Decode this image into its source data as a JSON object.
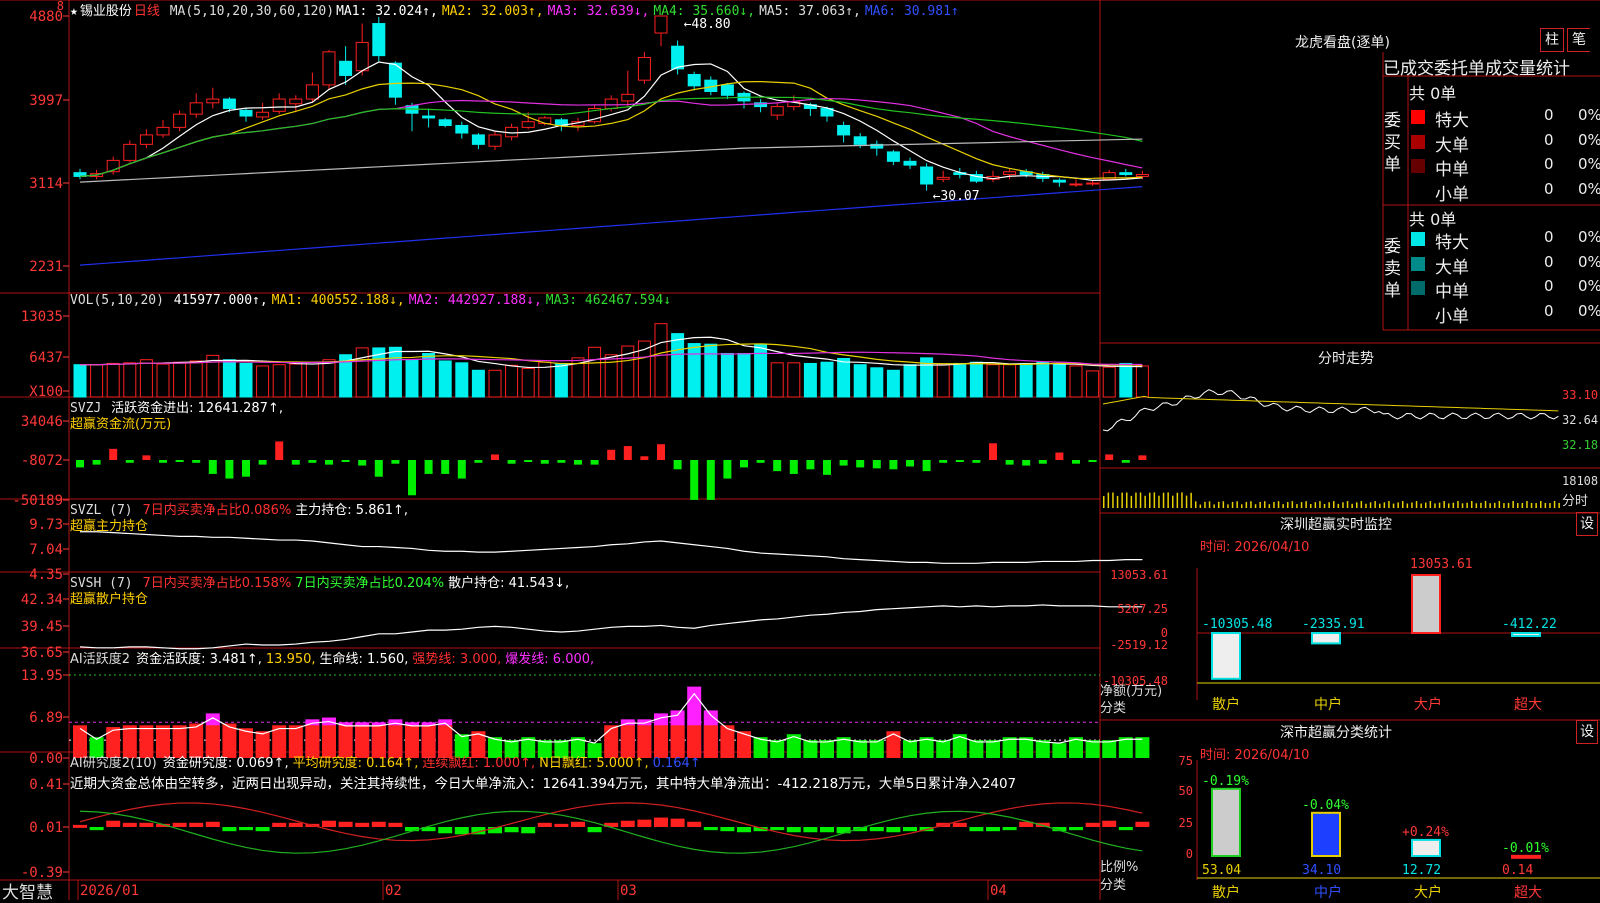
{
  "stock": {
    "name": "锡业股份",
    "period": "日线",
    "star": "★"
  },
  "header": {
    "ma": {
      "label": "MA(5,10,20,30,60,120)",
      "items": [
        {
          "t": "MA1: 32.024↑,",
          "c": "#ffffff"
        },
        {
          "t": "MA2: 32.003↑,",
          "c": "#ffd000"
        },
        {
          "t": "MA3: 32.639↓,",
          "c": "#ff30ff"
        },
        {
          "t": "MA4: 35.660↓,",
          "c": "#30dd30"
        },
        {
          "t": "MA5: 37.063↑,",
          "c": "#dddddd"
        },
        {
          "t": "MA6: 30.981↑",
          "c": "#3050ff"
        }
      ]
    },
    "vol": {
      "label": "VOL(5,10,20)",
      "items": [
        {
          "t": "415977.000↑,",
          "c": "#ffffff"
        },
        {
          "t": "MA1: 400552.188↓,",
          "c": "#ffd000"
        },
        {
          "t": "MA2: 442927.188↓,",
          "c": "#ff30ff"
        },
        {
          "t": "MA3: 462467.594↓",
          "c": "#30dd30"
        }
      ]
    },
    "svzj": {
      "label": "SVZJ",
      "items": [
        {
          "t": "活跃资金进出: 12641.287↑,",
          "c": "#ffffff"
        }
      ],
      "sub": "超赢资金流(万元)"
    },
    "svzl": {
      "label": "SVZL (7)",
      "items": [
        {
          "t": "7日内买卖净占比0.086%",
          "c": "#ff3030"
        },
        {
          "t": "主力持仓: 5.861↑,",
          "c": "#ffffff"
        }
      ],
      "sub": "超赢主力持仓"
    },
    "svsh": {
      "label": "SVSH (7)",
      "items": [
        {
          "t": "7日内买卖净占比0.158%",
          "c": "#ff3030"
        },
        {
          "t": "7日内买卖净占比0.204%",
          "c": "#30ff30"
        },
        {
          "t": "散户持仓: 41.543↓,",
          "c": "#ffffff"
        }
      ],
      "sub": "超赢散户持仓"
    },
    "ai": {
      "label": "AI活跃度2",
      "items": [
        {
          "t": "资金活跃度: 3.481↑,",
          "c": "#ffffff"
        },
        {
          "t": "13.950,",
          "c": "#ffd000"
        },
        {
          "t": "生命线: 1.560,",
          "c": "#ffffff"
        },
        {
          "t": "强势线: 3.000,",
          "c": "#ff3030"
        },
        {
          "t": "爆发线: 6.000,",
          "c": "#ff30ff"
        }
      ]
    },
    "ai2": {
      "label": "AI研究度2(10)",
      "items": [
        {
          "t": "资金研究度: 0.069↑,",
          "c": "#ffffff"
        },
        {
          "t": "平均研究度: 0.164↑,",
          "c": "#ffd000"
        },
        {
          "t": "连续飘红: 1.000↑,",
          "c": "#ff3030"
        },
        {
          "t": "N日飘红: 5.000↑,",
          "c": "#ffd000"
        },
        {
          "t": "0.164↑",
          "c": "#3050ff"
        }
      ],
      "comment": "近期大资金总体由空转多，近两日出现异动，关注其持续性，今日大单净流入：12641.394万元，其中特大单净流出：-412.218万元，大单5日累计净入2407"
    }
  },
  "axes": {
    "price": [
      "4880",
      "3997",
      "3114",
      "2231"
    ],
    "vol": [
      "13035",
      "6437",
      "X100"
    ],
    "svzj": [
      "34046",
      "-8072",
      "-50189"
    ],
    "svzl": [
      "9.73",
      "7.04",
      "4.35"
    ],
    "svsh": [
      "42.34",
      "39.45",
      "36.65"
    ],
    "ai": [
      "13.95",
      "6.89",
      "0.00"
    ],
    "ai2": [
      "0.41",
      "0.01",
      "-0.39"
    ]
  },
  "annotations": {
    "high": "48.80",
    "low": "30.07",
    "left_top_marker": "8"
  },
  "dates": {
    "labels": [
      "2026/01",
      "02",
      "03",
      "04"
    ],
    "brand": "大智慧"
  },
  "right": {
    "dragon": {
      "title": "龙虎看盘(逐单)",
      "btn1": "柱",
      "btn2": "笔",
      "tabs": "已成交委托单成交量统计",
      "buy": {
        "side": "委买单",
        "total": "共 0单",
        "rows": [
          {
            "name": "特大",
            "val": "0",
            "pct": "0%",
            "color": "#ff0000"
          },
          {
            "name": "大单",
            "val": "0",
            "pct": "0%",
            "color": "#aa0000"
          },
          {
            "name": "中单",
            "val": "0",
            "pct": "0%",
            "color": "#660000"
          },
          {
            "name": "小单",
            "val": "0",
            "pct": "0%",
            "color": "#000000"
          }
        ]
      },
      "sell": {
        "side": "委卖单",
        "total": "共 0单",
        "rows": [
          {
            "name": "特大",
            "val": "0",
            "pct": "0%",
            "color": "#00e5e5"
          },
          {
            "name": "大单",
            "val": "0",
            "pct": "0%",
            "color": "#008b8b"
          },
          {
            "name": "中单",
            "val": "0",
            "pct": "0%",
            "color": "#006b6b"
          },
          {
            "name": "小单",
            "val": "0",
            "pct": "0%",
            "color": "#000000"
          }
        ]
      }
    },
    "intraday": {
      "title": "分时走势",
      "prices": [
        "33.10",
        "32.64",
        "32.18"
      ],
      "vol": "18108",
      "vlabel": "分时"
    },
    "sz_monitor": {
      "title": "深圳超赢实时监控",
      "btn": "设",
      "time": "时间: 2026/04/10",
      "yticks": [
        "13053.61",
        "5267.25",
        "0",
        "-2519.12",
        "-10305.48"
      ],
      "ylabel": "净额(万元)",
      "xlabel": "分类"
    },
    "sz_class": {
      "title": "深市超赢分类统计",
      "btn": "设",
      "time": "时间: 2026/04/10",
      "yticks": [
        "75",
        "50",
        "25",
        "0"
      ],
      "ylabel": "比例%",
      "xlabel": "分类"
    }
  },
  "chart_data": [
    {
      "type": "candlestick",
      "title": "锡业股份 日线",
      "ylim": [
        2231,
        4880
      ],
      "x": [
        "2026/01",
        "02",
        "03",
        "04"
      ],
      "ohlc": [
        [
          3220,
          3180,
          3260,
          3150
        ],
        [
          3180,
          3210,
          3250,
          3150
        ],
        [
          3230,
          3350,
          3390,
          3200
        ],
        [
          3350,
          3520,
          3560,
          3330
        ],
        [
          3520,
          3620,
          3680,
          3480
        ],
        [
          3620,
          3700,
          3780,
          3590
        ],
        [
          3700,
          3840,
          3880,
          3660
        ],
        [
          3840,
          3960,
          4060,
          3800
        ],
        [
          3960,
          4000,
          4120,
          3900
        ],
        [
          4000,
          3900,
          4020,
          3860
        ],
        [
          3880,
          3820,
          3900,
          3760
        ],
        [
          3810,
          3860,
          3960,
          3780
        ],
        [
          3870,
          4000,
          4060,
          3840
        ],
        [
          3950,
          4000,
          4040,
          3860
        ],
        [
          4000,
          4150,
          4280,
          3960
        ],
        [
          4150,
          4500,
          4520,
          4100
        ],
        [
          4400,
          4250,
          4560,
          4150
        ],
        [
          4300,
          4600,
          4800,
          4250
        ],
        [
          4800,
          4460,
          4870,
          4400
        ],
        [
          4380,
          4020,
          4400,
          3940
        ],
        [
          3930,
          3850,
          3960,
          3660
        ],
        [
          3820,
          3800,
          3900,
          3700
        ],
        [
          3780,
          3720,
          3800,
          3700
        ],
        [
          3720,
          3640,
          3760,
          3580
        ],
        [
          3620,
          3520,
          3640,
          3470
        ],
        [
          3500,
          3620,
          3660,
          3460
        ],
        [
          3600,
          3700,
          3740,
          3560
        ],
        [
          3700,
          3760,
          3860,
          3680
        ],
        [
          3740,
          3800,
          3820,
          3720
        ],
        [
          3780,
          3720,
          3800,
          3660
        ],
        [
          3720,
          3760,
          3800,
          3660
        ],
        [
          3760,
          3900,
          3940,
          3740
        ],
        [
          3900,
          4000,
          4040,
          3870
        ],
        [
          3980,
          4050,
          4300,
          3920
        ],
        [
          4200,
          4440,
          4500,
          4160
        ],
        [
          4700,
          4880,
          4880,
          4560
        ],
        [
          4560,
          4320,
          4620,
          4260
        ],
        [
          4260,
          4140,
          4290,
          4090
        ],
        [
          4200,
          4080,
          4240,
          4040
        ],
        [
          4150,
          4040,
          4170,
          4000
        ],
        [
          4060,
          3980,
          4080,
          3900
        ],
        [
          3960,
          3920,
          4000,
          3860
        ],
        [
          3830,
          3920,
          3960,
          3780
        ],
        [
          3920,
          3970,
          4040,
          3880
        ],
        [
          3940,
          3900,
          3960,
          3820
        ],
        [
          3900,
          3820,
          3920,
          3760
        ],
        [
          3720,
          3620,
          3760,
          3540
        ],
        [
          3600,
          3520,
          3640,
          3480
        ],
        [
          3520,
          3480,
          3560,
          3400
        ],
        [
          3440,
          3340,
          3460,
          3300
        ],
        [
          3340,
          3300,
          3380,
          3260
        ],
        [
          3280,
          3100,
          3320,
          3030
        ],
        [
          3150,
          3170,
          3240,
          3120
        ],
        [
          3220,
          3200,
          3270,
          3160
        ],
        [
          3200,
          3130,
          3240,
          3110
        ],
        [
          3150,
          3180,
          3240,
          3120
        ],
        [
          3200,
          3230,
          3260,
          3150
        ],
        [
          3230,
          3200,
          3260,
          3170
        ],
        [
          3200,
          3160,
          3230,
          3120
        ],
        [
          3140,
          3120,
          3160,
          3070
        ],
        [
          3100,
          3100,
          3150,
          3070
        ],
        [
          3100,
          3110,
          3140,
          3080
        ],
        [
          3150,
          3220,
          3250,
          3140
        ],
        [
          3220,
          3200,
          3260,
          3180
        ],
        [
          3180,
          3200,
          3240,
          3150
        ]
      ]
    },
    {
      "type": "bar",
      "title": "VOL(5,10,20)",
      "ylim": [
        0,
        13035
      ],
      "values": [
        5200,
        5200,
        5400,
        5500,
        6000,
        5300,
        5600,
        5800,
        6700,
        6000,
        5400,
        5000,
        5200,
        5300,
        5600,
        6000,
        6800,
        7900,
        7900,
        8000,
        6000,
        7000,
        5800,
        5500,
        4300,
        4300,
        5100,
        4600,
        5600,
        5400,
        6300,
        8000,
        6800,
        8200,
        9000,
        11800,
        10200,
        8600,
        8500,
        7000,
        7000,
        8500,
        5500,
        5500,
        5400,
        5600,
        6200,
        5200,
        4700,
        4300,
        5200,
        6300,
        5200,
        5400,
        5600,
        5200,
        5200,
        5400,
        5600,
        5200,
        5000,
        4200,
        4800,
        5400,
        5000
      ]
    },
    {
      "type": "bar",
      "title": "SVZJ 超赢资金流(万元)",
      "ylim": [
        -50189,
        34046
      ],
      "values": [
        -8000,
        -5000,
        12000,
        -3000,
        5000,
        -3000,
        -2000,
        -3000,
        -15000,
        -20000,
        -18000,
        -5000,
        20000,
        -5000,
        -3000,
        -5000,
        -2000,
        -6000,
        -18000,
        -4000,
        -38000,
        -15000,
        -15000,
        -20000,
        -3000,
        6000,
        -4000,
        -2000,
        -4000,
        -3000,
        -5000,
        -5000,
        11000,
        15000,
        4000,
        17000,
        -10000,
        -43000,
        -43000,
        -20000,
        -8000,
        -3000,
        -12000,
        -15000,
        -10000,
        -16000,
        -6000,
        -8000,
        -9000,
        -10000,
        -7000,
        -12000,
        -3000,
        -2000,
        -3000,
        18000,
        -5000,
        -6000,
        -4000,
        8000,
        -4000,
        -2000,
        6000,
        -3000,
        5000
      ]
    },
    {
      "type": "line",
      "title": "SVZL 超赢主力持仓",
      "ylim": [
        4.35,
        9.73
      ],
      "values": [
        8.9,
        8.9,
        8.8,
        8.7,
        8.6,
        8.5,
        8.4,
        8.4,
        8.3,
        8.3,
        8.2,
        8.1,
        8.0,
        8.0,
        7.9,
        7.7,
        7.5,
        7.3,
        7.3,
        7.2,
        7.1,
        6.9,
        6.8,
        6.8,
        6.7,
        6.7,
        6.8,
        6.9,
        7.0,
        7.1,
        7.2,
        7.3,
        7.5,
        7.6,
        7.8,
        7.9,
        7.7,
        7.5,
        7.3,
        7.1,
        6.8,
        6.6,
        6.5,
        6.4,
        6.3,
        6.2,
        6.0,
        5.9,
        5.8,
        5.7,
        5.6,
        5.6,
        5.5,
        5.5,
        5.5,
        5.6,
        5.6,
        5.6,
        5.7,
        5.7,
        5.7,
        5.8,
        5.8,
        5.9,
        5.9
      ]
    },
    {
      "type": "line",
      "title": "SVSH 超赢散户持仓",
      "ylim": [
        36.65,
        42.34
      ],
      "values": [
        37.2,
        37.1,
        37.1,
        37.2,
        37.2,
        37.1,
        37.0,
        37.0,
        37.1,
        37.3,
        37.5,
        37.4,
        37.4,
        37.5,
        37.7,
        37.8,
        38.0,
        38.3,
        38.6,
        38.6,
        38.8,
        39.0,
        39.0,
        39.1,
        39.3,
        39.4,
        39.3,
        39.1,
        38.9,
        38.8,
        38.9,
        39.1,
        39.3,
        39.4,
        39.4,
        39.5,
        39.3,
        39.2,
        39.5,
        39.7,
        39.9,
        40.1,
        40.2,
        40.4,
        40.6,
        40.7,
        40.9,
        41.0,
        41.2,
        41.3,
        41.4,
        41.5,
        41.6,
        41.5,
        41.6,
        41.5,
        41.6,
        41.6,
        41.7,
        41.6,
        41.6,
        41.6,
        41.5,
        41.5,
        41.5
      ]
    },
    {
      "type": "bar",
      "title": "AI活跃度2",
      "ylim": [
        0,
        13.95
      ],
      "values": [
        5.5,
        3.5,
        5.2,
        5.5,
        5.5,
        5.5,
        5.5,
        5.8,
        7.5,
        5.8,
        5.0,
        4.5,
        5.5,
        5.5,
        6.5,
        6.8,
        6.0,
        6.0,
        6.0,
        6.5,
        6.0,
        6.0,
        6.5,
        4.0,
        4.5,
        3.5,
        3.0,
        3.5,
        3.0,
        3.0,
        3.5,
        2.5,
        5.5,
        6.5,
        6.5,
        7.5,
        8.0,
        12.0,
        8.0,
        5.5,
        4.5,
        3.5,
        3.0,
        4.0,
        3.0,
        3.0,
        3.5,
        3.0,
        3.0,
        4.5,
        3.0,
        3.5,
        3.0,
        4.0,
        3.0,
        3.0,
        3.5,
        3.5,
        3.0,
        2.5,
        3.5,
        3.0,
        3.0,
        3.5,
        3.5
      ]
    },
    {
      "type": "bar",
      "title": "AI研究度2(10)",
      "ylim": [
        -0.39,
        0.41
      ],
      "values": [
        0.02,
        -0.03,
        0.06,
        0.04,
        0.04,
        0.03,
        0.04,
        0.04,
        0.05,
        -0.04,
        -0.03,
        -0.04,
        0.04,
        0.04,
        0.03,
        0.06,
        0.05,
        0.04,
        0.05,
        0.04,
        -0.04,
        -0.04,
        -0.06,
        -0.07,
        -0.07,
        -0.06,
        -0.05,
        -0.06,
        0.04,
        0.03,
        0.05,
        -0.05,
        0.04,
        0.06,
        0.07,
        0.09,
        0.08,
        0.05,
        -0.03,
        -0.04,
        -0.05,
        -0.04,
        -0.03,
        -0.05,
        -0.05,
        -0.05,
        -0.06,
        -0.04,
        -0.04,
        -0.05,
        -0.04,
        -0.04,
        0.04,
        0.04,
        -0.04,
        -0.04,
        -0.03,
        0.05,
        0.04,
        -0.04,
        -0.03,
        0.04,
        0.06,
        -0.03,
        0.05
      ]
    },
    {
      "type": "bar",
      "title": "深圳超赢实时监控",
      "categories": [
        "散户",
        "中户",
        "大户",
        "超大"
      ],
      "values": [
        -10305.48,
        -2335.91,
        13053.61,
        -412.22
      ],
      "ylim": [
        -10305.48,
        13053.61
      ]
    },
    {
      "type": "bar",
      "title": "深市超赢分类统计",
      "categories": [
        "散户",
        "中户",
        "大户",
        "超大"
      ],
      "values": [
        53.04,
        34.1,
        12.72,
        0.14
      ],
      "changes": [
        "-0.19%",
        "-0.04%",
        "+0.24%",
        "-0.01%"
      ],
      "ylim": [
        0,
        75
      ]
    }
  ]
}
